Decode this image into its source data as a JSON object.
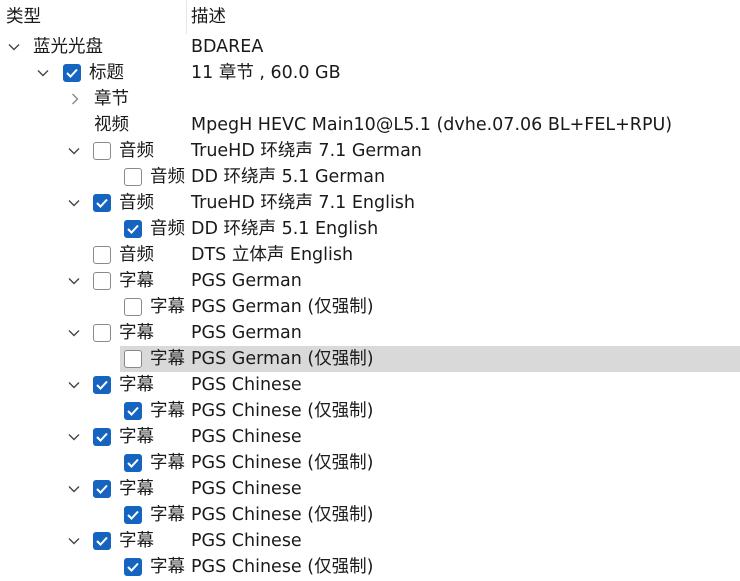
{
  "header": {
    "col_type": "类型",
    "col_desc": "描述"
  },
  "tree": [
    {
      "label": "蓝光光盘",
      "desc": "BDAREA",
      "level": 0,
      "expander": "expanded",
      "checkbox": "none",
      "selected": false
    },
    {
      "label": "标题",
      "desc": "11 章节 , 60.0 GB",
      "level": 1,
      "expander": "expanded",
      "checkbox": "checked",
      "selected": false
    },
    {
      "label": "章节",
      "desc": "",
      "level": 2,
      "expander": "collapsed",
      "checkbox": "none",
      "selected": false
    },
    {
      "label": "视频",
      "desc": "MpegH HEVC Main10@L5.1 (dvhe.07.06 BL+FEL+RPU)",
      "level": 2,
      "expander": "none",
      "checkbox": "none",
      "selected": false
    },
    {
      "label": "音频",
      "desc": "TrueHD 环绕声 7.1 German",
      "level": 2,
      "expander": "expanded",
      "checkbox": "unchecked",
      "selected": false
    },
    {
      "label": "音频",
      "desc": "DD 环绕声 5.1 German",
      "level": 3,
      "expander": "none",
      "checkbox": "unchecked",
      "selected": false
    },
    {
      "label": "音频",
      "desc": "TrueHD 环绕声 7.1 English",
      "level": 2,
      "expander": "expanded",
      "checkbox": "checked",
      "selected": false
    },
    {
      "label": "音频",
      "desc": "DD 环绕声 5.1 English",
      "level": 3,
      "expander": "none",
      "checkbox": "checked",
      "selected": false
    },
    {
      "label": "音频",
      "desc": "DTS 立体声 English",
      "level": 2,
      "expander": "none",
      "checkbox": "unchecked",
      "selected": false
    },
    {
      "label": "字幕",
      "desc": "PGS German",
      "level": 2,
      "expander": "expanded",
      "checkbox": "unchecked",
      "selected": false
    },
    {
      "label": "字幕",
      "desc": "PGS German  (仅强制)",
      "level": 3,
      "expander": "none",
      "checkbox": "unchecked",
      "selected": false
    },
    {
      "label": "字幕",
      "desc": "PGS German",
      "level": 2,
      "expander": "expanded",
      "checkbox": "unchecked",
      "selected": false
    },
    {
      "label": "字幕",
      "desc": "PGS German  (仅强制)",
      "level": 3,
      "expander": "none",
      "checkbox": "unchecked",
      "selected": true
    },
    {
      "label": "字幕",
      "desc": "PGS Chinese",
      "level": 2,
      "expander": "expanded",
      "checkbox": "checked",
      "selected": false
    },
    {
      "label": "字幕",
      "desc": "PGS Chinese  (仅强制)",
      "level": 3,
      "expander": "none",
      "checkbox": "checked",
      "selected": false
    },
    {
      "label": "字幕",
      "desc": "PGS Chinese",
      "level": 2,
      "expander": "expanded",
      "checkbox": "checked",
      "selected": false
    },
    {
      "label": "字幕",
      "desc": "PGS Chinese  (仅强制)",
      "level": 3,
      "expander": "none",
      "checkbox": "checked",
      "selected": false
    },
    {
      "label": "字幕",
      "desc": "PGS Chinese",
      "level": 2,
      "expander": "expanded",
      "checkbox": "checked",
      "selected": false
    },
    {
      "label": "字幕",
      "desc": "PGS Chinese  (仅强制)",
      "level": 3,
      "expander": "none",
      "checkbox": "checked",
      "selected": false
    },
    {
      "label": "字幕",
      "desc": "PGS Chinese",
      "level": 2,
      "expander": "expanded",
      "checkbox": "checked",
      "selected": false
    },
    {
      "label": "字幕",
      "desc": "PGS Chinese  (仅强制)",
      "level": 3,
      "expander": "none",
      "checkbox": "checked",
      "selected": false
    }
  ],
  "colors": {
    "accent": "#1565c0",
    "selection": "#d9d9d9",
    "checkbox_border": "#8a8a8a"
  }
}
